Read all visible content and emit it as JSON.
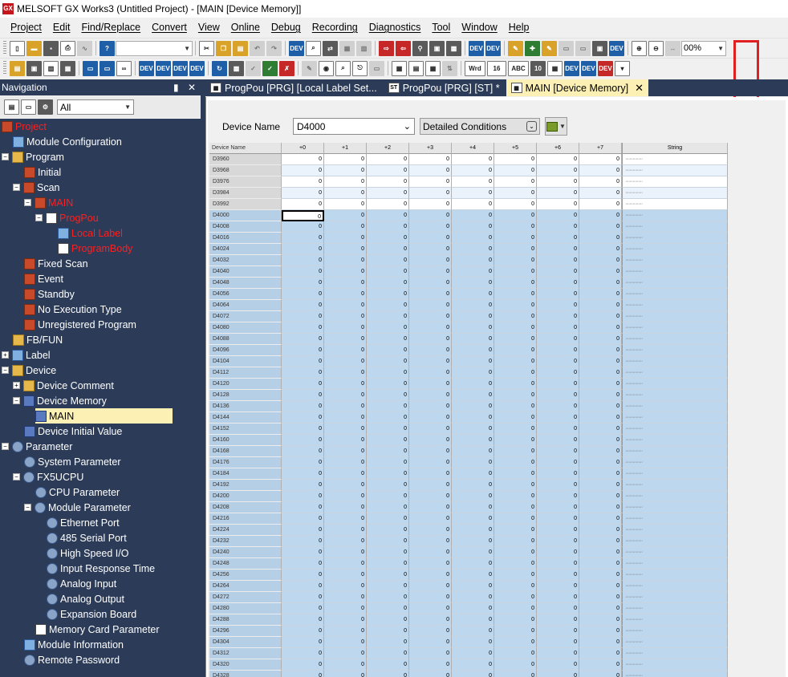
{
  "window": {
    "title": "MELSOFT GX Works3 (Untitled Project) - [MAIN [Device Memory]]"
  },
  "menu": [
    "Project",
    "Edit",
    "Find/Replace",
    "Convert",
    "View",
    "Online",
    "Debug",
    "Recording",
    "Diagnostics",
    "Tool",
    "Window",
    "Help"
  ],
  "toolbar": {
    "zoom_value": "00%",
    "highlight_color": "#e02020"
  },
  "navigation": {
    "title": "Navigation",
    "pin": "▮",
    "close": "✕",
    "filter_value": "All",
    "tree": [
      {
        "label": "Project",
        "red": true
      },
      {
        "label": "Module Configuration"
      },
      {
        "label": "Program"
      },
      {
        "label": "Initial"
      },
      {
        "label": "Scan"
      },
      {
        "label": "MAIN",
        "red": true
      },
      {
        "label": "ProgPou",
        "red": true
      },
      {
        "label": "Local Label",
        "red": true
      },
      {
        "label": "ProgramBody",
        "red": true
      },
      {
        "label": "Fixed Scan"
      },
      {
        "label": "Event"
      },
      {
        "label": "Standby"
      },
      {
        "label": "No Execution Type"
      },
      {
        "label": "Unregistered Program"
      },
      {
        "label": "FB/FUN"
      },
      {
        "label": "Label"
      },
      {
        "label": "Device"
      },
      {
        "label": "Device Comment"
      },
      {
        "label": "Device Memory"
      },
      {
        "label": "MAIN",
        "selected": true
      },
      {
        "label": "Device Initial Value"
      },
      {
        "label": "Parameter"
      },
      {
        "label": "System Parameter"
      },
      {
        "label": "FX5UCPU"
      },
      {
        "label": "CPU Parameter"
      },
      {
        "label": "Module Parameter"
      },
      {
        "label": "Ethernet Port"
      },
      {
        "label": "485 Serial Port"
      },
      {
        "label": "High Speed I/O"
      },
      {
        "label": "Input Response Time"
      },
      {
        "label": "Analog Input"
      },
      {
        "label": "Analog Output"
      },
      {
        "label": "Expansion Board"
      },
      {
        "label": "Memory Card Parameter"
      },
      {
        "label": "Module Information"
      },
      {
        "label": "Remote Password"
      }
    ]
  },
  "tabs": [
    {
      "label": "ProgPou [PRG] [Local Label Set...",
      "icon": "▦"
    },
    {
      "label": "ProgPou [PRG] [ST] *",
      "icon": "ST"
    },
    {
      "label": "MAIN [Device Memory]",
      "icon": "▦",
      "active": true,
      "close": "✕"
    }
  ],
  "device_memory": {
    "device_name_label": "Device Name",
    "device_name_value": "D4000",
    "detailed_conditions": "Detailed Conditions",
    "columns": {
      "name": "Device Name",
      "offsets": [
        "+0",
        "+1",
        "+2",
        "+3",
        "+4",
        "+5",
        "+6",
        "+7"
      ],
      "string": "String"
    },
    "string_placeholder": "················",
    "cell_value": "0",
    "rows_above": [
      "D3960",
      "D3968",
      "D3976",
      "D3984",
      "D3992"
    ],
    "rows_main": [
      "D4000",
      "D4008",
      "D4016",
      "D4024",
      "D4032",
      "D4040",
      "D4048",
      "D4056",
      "D4064",
      "D4072",
      "D4080",
      "D4088",
      "D4096",
      "D4104",
      "D4112",
      "D4120",
      "D4128",
      "D4136",
      "D4144",
      "D4152",
      "D4160",
      "D4168",
      "D4176",
      "D4184",
      "D4192",
      "D4200",
      "D4208",
      "D4216",
      "D4224",
      "D4232",
      "D4240",
      "D4248",
      "D4256",
      "D4264",
      "D4272",
      "D4280",
      "D4288",
      "D4296",
      "D4304",
      "D4312",
      "D4320",
      "D4328"
    ]
  }
}
